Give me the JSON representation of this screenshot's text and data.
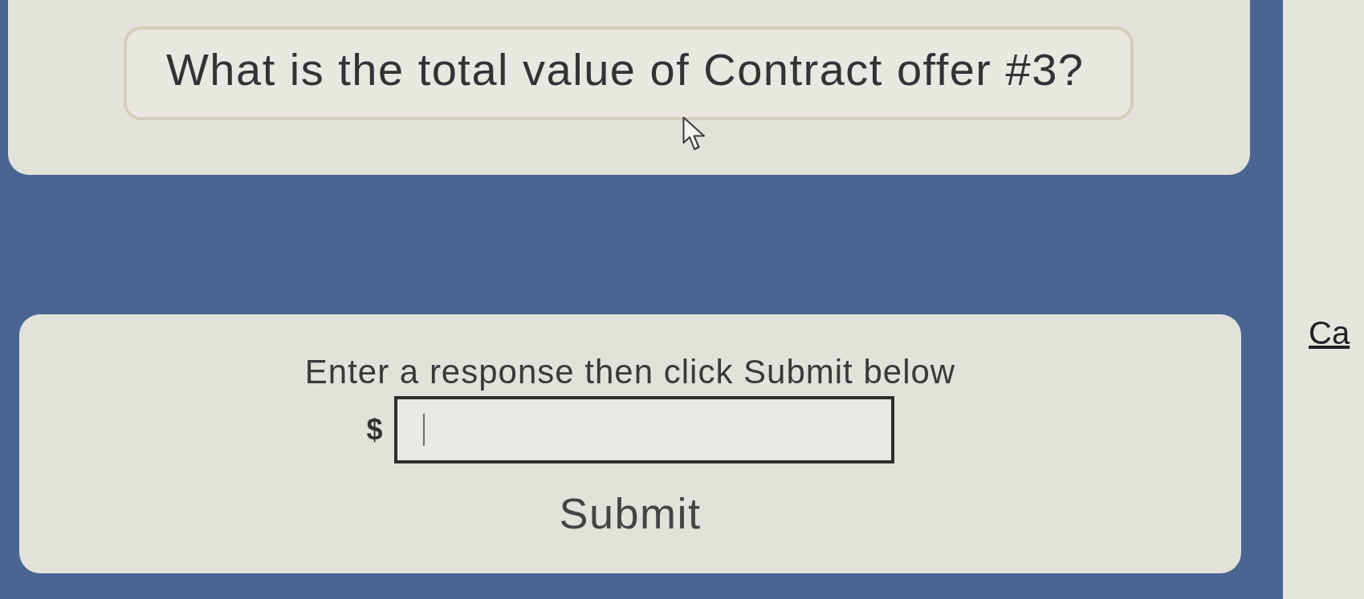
{
  "question": {
    "text": "What is the total value of Contract offer #3?"
  },
  "response": {
    "instruction": "Enter a response then click Submit below",
    "currency": "$",
    "answer": {
      "focused": true
    },
    "submit": {
      "label": "Submit"
    }
  },
  "side_link": {
    "label": "Ca"
  }
}
